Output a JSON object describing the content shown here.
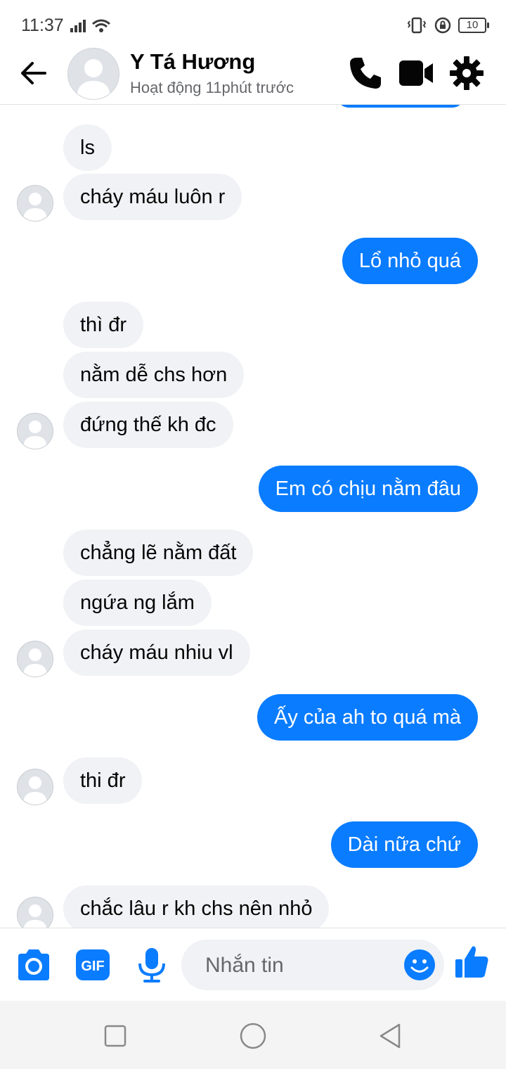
{
  "status_bar": {
    "time": "11:37",
    "battery": "10"
  },
  "header": {
    "contact_name": "Y Tá Hương",
    "activity_status": "Hoạt động 11phút trước"
  },
  "messages": [
    {
      "sender": "them",
      "text": "ls"
    },
    {
      "sender": "them",
      "text": "cháy máu luôn r"
    },
    {
      "sender": "me",
      "text": "Lổ nhỏ quá"
    },
    {
      "sender": "them",
      "text": "thì đr"
    },
    {
      "sender": "them",
      "text": "nằm dễ chs hơn"
    },
    {
      "sender": "them",
      "text": "đứng thế kh đc"
    },
    {
      "sender": "me",
      "text": "Em có chịu nằm đâu"
    },
    {
      "sender": "them",
      "text": "chẳng lẽ nằm đất"
    },
    {
      "sender": "them",
      "text": "ngứa ng lắm"
    },
    {
      "sender": "them",
      "text": "cháy máu nhiu vl"
    },
    {
      "sender": "me",
      "text": "Ấy của ah to quá mà"
    },
    {
      "sender": "them",
      "text": "thi đr"
    },
    {
      "sender": "me",
      "text": "Dài nữa chứ"
    },
    {
      "sender": "them",
      "text": "chắc lâu r kh  chs nên nhỏ"
    }
  ],
  "composer": {
    "placeholder": "Nhắn tin",
    "gif_label": "GIF"
  },
  "colors": {
    "accent": "#0a7cff",
    "incoming_bubble": "#f0f2f5",
    "icon_blue": "#0a7cff"
  },
  "icons": [
    "back-arrow-icon",
    "phone-icon",
    "video-camera-icon",
    "gear-icon",
    "camera-icon",
    "gif-icon",
    "microphone-icon",
    "emoji-icon",
    "thumbs-up-icon",
    "recent-apps-icon",
    "home-icon",
    "back-triangle-icon"
  ]
}
